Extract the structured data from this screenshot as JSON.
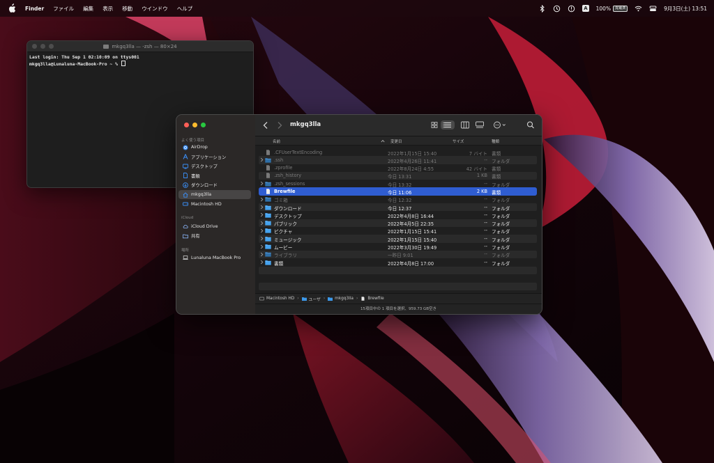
{
  "menubar": {
    "app_name": "Finder",
    "items": [
      "ファイル",
      "編集",
      "表示",
      "移動",
      "ウインドウ",
      "ヘルプ"
    ],
    "input_badge": "A",
    "battery_percent": "100%",
    "battery_label": "充電済",
    "datetime": "9月3日(土) 13:51"
  },
  "terminal": {
    "title": "mkgq3lla — -zsh — 80×24",
    "lines": [
      "Last login: Thu Sep  1 02:10:09 on ttys001",
      "mkgq3lla@Lunaluna-MacBook-Pro ~ % "
    ]
  },
  "finder": {
    "folder_title": "mkgq3lla",
    "sidebar": {
      "favorites_label": "よく使う項目",
      "favorites": [
        {
          "label": "AirDrop",
          "icon": "airdrop-icon"
        },
        {
          "label": "アプリケーション",
          "icon": "applications-icon"
        },
        {
          "label": "デスクトップ",
          "icon": "desktop-icon"
        },
        {
          "label": "書類",
          "icon": "document-icon"
        },
        {
          "label": "ダウンロード",
          "icon": "download-icon"
        },
        {
          "label": "mkgq3lla",
          "icon": "home-icon",
          "selected": true
        },
        {
          "label": "Macintosh HD",
          "icon": "disk-icon"
        }
      ],
      "icloud_label": "iCloud",
      "icloud": [
        {
          "label": "iCloud Drive",
          "icon": "cloud-icon"
        },
        {
          "label": "共有",
          "icon": "shared-folder-icon"
        }
      ],
      "locations_label": "場所",
      "locations": [
        {
          "label": "Lunaluna MacBook Pro",
          "icon": "laptop-icon"
        }
      ]
    },
    "columns": {
      "name": "名前",
      "date": "変更日",
      "size": "サイズ",
      "kind": "種類"
    },
    "rows": [
      {
        "name": ".CFUserTextEncoding",
        "date": "2022年1月15日 15:40",
        "size": "7 バイト",
        "kind": "書類",
        "type": "file",
        "expandable": false,
        "dim": true
      },
      {
        "name": ".ssh",
        "date": "2022年4月26日 11:41",
        "size": "--",
        "kind": "フォルダ",
        "type": "folder",
        "expandable": true,
        "dim": true
      },
      {
        "name": ".zprofile",
        "date": "2022年8月24日 4:55",
        "size": "42 バイト",
        "kind": "書類",
        "type": "file",
        "expandable": false,
        "dim": true
      },
      {
        "name": ".zsh_history",
        "date": "今日 13:31",
        "size": "1 KB",
        "kind": "書類",
        "type": "file",
        "expandable": false,
        "dim": true
      },
      {
        "name": ".zsh_sessions",
        "date": "今日 13:32",
        "size": "--",
        "kind": "フォルダ",
        "type": "folder",
        "expandable": true,
        "dim": true
      },
      {
        "name": "Brewfile",
        "date": "今日 11:06",
        "size": "2 KB",
        "kind": "書類",
        "type": "file",
        "expandable": false,
        "selected": true
      },
      {
        "name": "ゴミ箱",
        "date": "今日 12:32",
        "size": "--",
        "kind": "フォルダ",
        "type": "folder",
        "expandable": true,
        "dim": true
      },
      {
        "name": "ダウンロード",
        "date": "今日 12:37",
        "size": "--",
        "kind": "フォルダ",
        "type": "folder",
        "expandable": true
      },
      {
        "name": "デスクトップ",
        "date": "2022年4月8日 16:44",
        "size": "--",
        "kind": "フォルダ",
        "type": "folder",
        "expandable": true
      },
      {
        "name": "パブリック",
        "date": "2022年4月5日 22:35",
        "size": "--",
        "kind": "フォルダ",
        "type": "folder",
        "expandable": true
      },
      {
        "name": "ピクチャ",
        "date": "2022年1月15日 15:41",
        "size": "--",
        "kind": "フォルダ",
        "type": "folder",
        "expandable": true
      },
      {
        "name": "ミュージック",
        "date": "2022年1月15日 15:40",
        "size": "--",
        "kind": "フォルダ",
        "type": "folder",
        "expandable": true
      },
      {
        "name": "ムービー",
        "date": "2022年3月30日 19:49",
        "size": "--",
        "kind": "フォルダ",
        "type": "folder",
        "expandable": true
      },
      {
        "name": "ライブラリ",
        "date": "一昨日 9:01",
        "size": "--",
        "kind": "フォルダ",
        "type": "folder",
        "expandable": true,
        "dim": true
      },
      {
        "name": "書類",
        "date": "2022年4月8日 17:00",
        "size": "--",
        "kind": "フォルダ",
        "type": "folder",
        "expandable": true
      }
    ],
    "path": [
      "Macintosh HD",
      "ユーザ",
      "mkgq3lla",
      "Brewfile"
    ],
    "status": "15項目中の 1 項目を選択、959.73 GB空き"
  }
}
